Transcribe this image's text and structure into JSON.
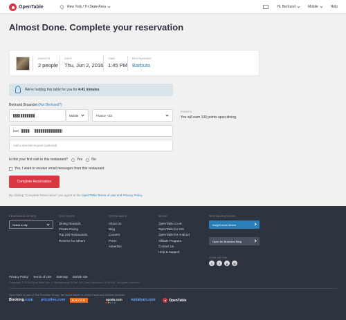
{
  "header": {
    "logo_text": "OpenTable",
    "location": "New York / Tri-State Area",
    "greeting": "Hi, Bertrand",
    "mobile": "Mobile",
    "help": "Help"
  },
  "page_title": "Almost Done. Complete your reservation",
  "summary": {
    "guests_label": "GUESTS",
    "guests_value": "2 people",
    "date_label": "DATE",
    "date_value": "Thu, Jun 2, 2016",
    "time_label": "TIME",
    "time_value": "1:45 PM",
    "restaurant_label": "RESTAURANT",
    "restaurant_value": "Barbuto"
  },
  "hold_notice": {
    "prefix": "We're holding this table for you for ",
    "timer": "4:41 minutes"
  },
  "form": {
    "diner_name": "Bertrand Bruandet",
    "not_you": "(Not Bertrand?)",
    "phone_type": "Mobile",
    "country": "France +33",
    "email_prefix": "bert",
    "special_request_placeholder": "Add a special request (optional)",
    "first_visit_question": "Is this your first visit to this restaurant?",
    "yes": "Yes",
    "no": "No",
    "optin": "Yes, I want to receive email messages from this restaurant.",
    "submit": "Complete Reservation",
    "terms_prefix": "By clicking “Complete Reservation” you agree to the ",
    "terms_link": "OpenTable Terms of Use and Privacy Policy."
  },
  "points": {
    "label": "POINTS",
    "text": "You will earn 100 points upon dining."
  },
  "footer": {
    "featured_cities_label": "FEATURED CITIES",
    "select_city": "Select a city",
    "discover_label": "DISCOVER",
    "discover_links": [
      "Dining Rewards",
      "Private Dining",
      "Top 100 Restaurants",
      "Reserve for Others"
    ],
    "opentable_label": "OPENTABLE",
    "opentable_links": [
      "About Us",
      "Blog",
      "Careers",
      "Press",
      "Advertise"
    ],
    "more_label": "MORE",
    "more_links": [
      "OpenTable.co.uk",
      "OpenTable for iOS",
      "OpenTable for Android",
      "Affiliate Program",
      "Contact Us",
      "Help & Support"
    ],
    "restaurateurs_label": "RESTAURATEURS",
    "insight_button": "Insight more diners",
    "business_blog_button": "Open for Business Blog",
    "join_us_label": "JOIN US ON",
    "bottom_links": [
      "Privacy Policy",
      "Terms of Use",
      "Sitemap",
      "Mobile site"
    ],
    "copyright": "Copyright © 2016 OpenTable, Inc. 1 Montgomery St Ste 700, San Francisco CA 94104 - All rights reserved.",
    "family_note": "OpenTable is part of The Priceline Group, the world leader in online travel and related services.",
    "brands": {
      "booking": "Booking",
      "booking_suffix": ".com",
      "priceline": "priceline.com",
      "kayak": "KAYAK",
      "agoda": "agoda.com",
      "rentalcars": "rentalcars.com",
      "opentable": "OpenTable"
    }
  },
  "colors": {
    "brand_red": "#da3743",
    "link_blue": "#2b7fb6",
    "footer_bg": "#2d333f"
  }
}
